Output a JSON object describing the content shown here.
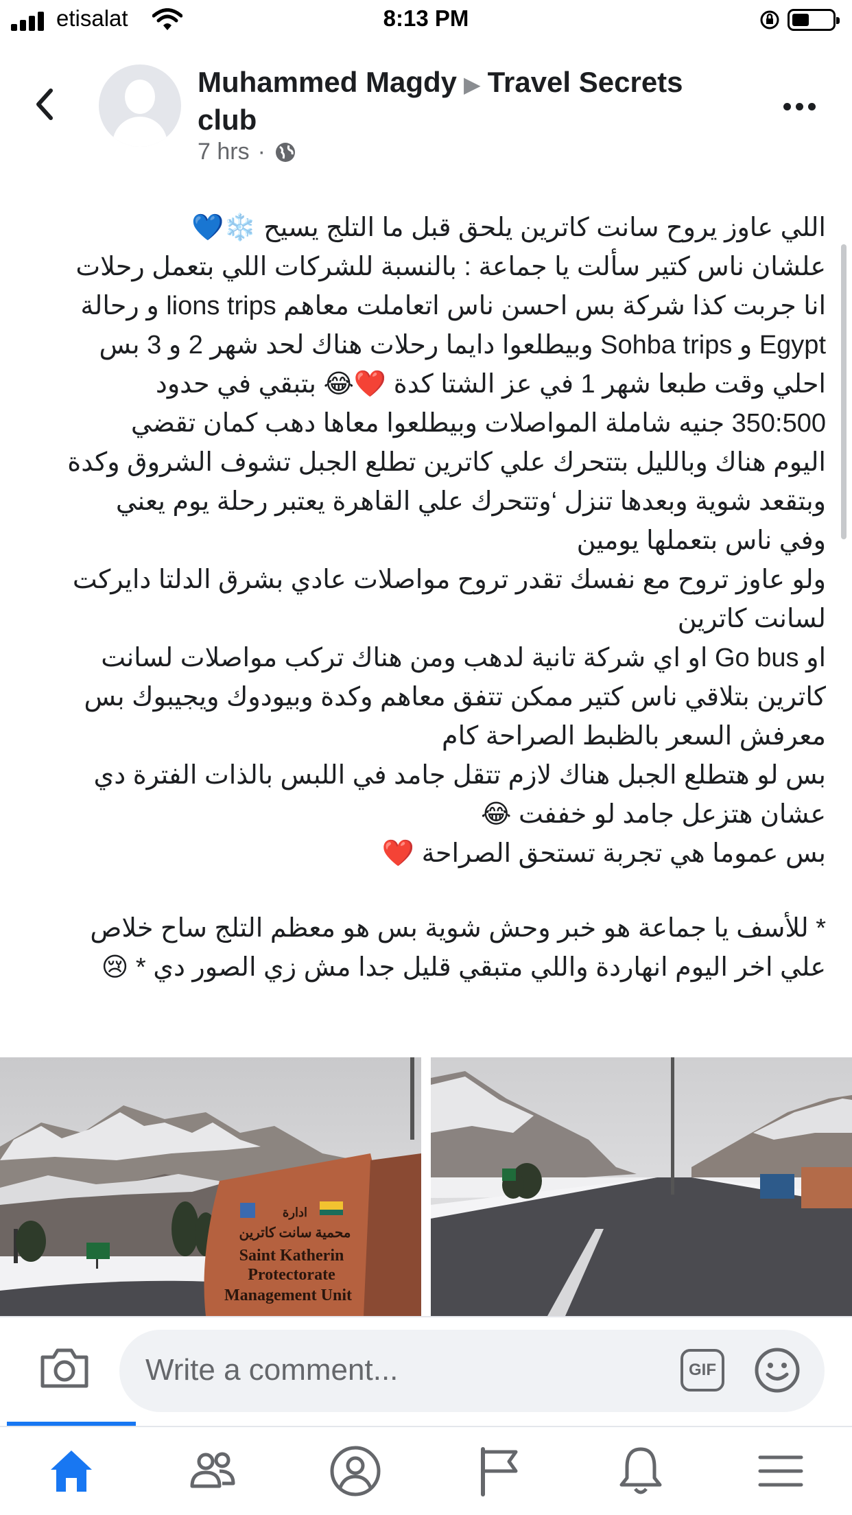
{
  "status_bar": {
    "carrier": "etisalat",
    "time": "8:13 PM"
  },
  "header": {
    "author": "Muhammed Magdy",
    "group": "Travel Secrets club",
    "time_ago": "7 hrs",
    "privacy_icon": "globe-icon"
  },
  "post": {
    "lines": [
      "اللي عاوز يروح سانت كاترين يلحق قبل ما التلج يسيح ❄️💙",
      "علشان ناس كتير سألت يا جماعة : بالنسبة للشركات اللي بتعمل رحلات",
      "انا جربت كذا شركة بس احسن ناس اتعاملت معاهم lions trips و رحالة",
      "Egypt و Sohba trips وبيطلعوا دايما رحلات هناك لحد شهر 2 و 3 بس",
      "احلي وقت طبعا شهر 1 في عز الشتا كدة ❤️😂 بتبقي في حدود",
      "350:500 جنيه شاملة المواصلات وبيطلعوا معاها دهب كمان تقضي",
      "اليوم هناك وبالليل بتتحرك علي كاترين تطلع الجبل تشوف الشروق وكدة",
      "وبتقعد شوية وبعدها تنزل ‘وتتحرك علي القاهرة يعتبر رحلة يوم يعني",
      "وفي ناس بتعملها يومين",
      "ولو عاوز تروح مع نفسك تقدر تروح مواصلات عادي بشرق الدلتا دايركت",
      "لسانت كاترين",
      "او Go bus  او اي شركة تانية لدهب ومن هناك تركب مواصلات لسانت",
      "كاترين بتلاقي ناس كتير ممكن تتفق معاهم وكدة وبيودوك ويجيبوك بس",
      "معرفش السعر بالظبط الصراحة كام",
      "بس لو هتطلع الجبل هناك لازم تتقل جامد في اللبس بالذات الفترة دي",
      "عشان هتزعل جامد لو خففت 😂",
      "بس عموما هي تجربة تستحق الصراحة ❤️"
    ],
    "footer_lines": [
      "* للأسف يا جماعة هو خبر وحش شوية بس هو معظم التلج ساح خلاص",
      "علي اخر اليوم انهاردة واللي متبقي قليل جدا مش زي الصور دي * 😢"
    ]
  },
  "photos": {
    "sign_lines": [
      "ادارة",
      "محمية سانت كاترين",
      "Saint Katherin",
      "Protectorate",
      "Management Unit"
    ]
  },
  "comment_bar": {
    "placeholder": "Write a comment...",
    "gif_label": "GIF"
  },
  "tabs": [
    "home-icon",
    "groups-icon",
    "profile-icon",
    "pages-icon",
    "notifications-icon",
    "menu-icon"
  ],
  "colors": {
    "accent": "#1877f2",
    "text": "#1c1e21",
    "secondary": "#65676b"
  }
}
